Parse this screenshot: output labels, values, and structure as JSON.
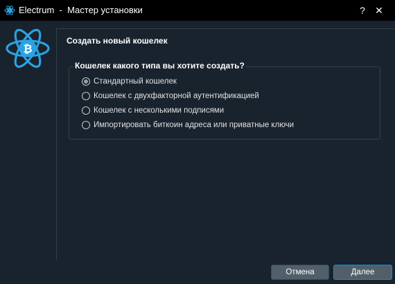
{
  "window": {
    "title": "Electrum  -  Мастер установки",
    "help_label": "?",
    "close_label": "✕"
  },
  "panel": {
    "title": "Создать новый кошелек",
    "group_title": "Кошелек какого типа вы хотите создать?",
    "options": [
      {
        "label": "Стандартный кошелек",
        "checked": true
      },
      {
        "label": "Кошелек с двухфакторной аутентификацией",
        "checked": false
      },
      {
        "label": "Кошелек с несколькими подписями",
        "checked": false
      },
      {
        "label": "Импортировать биткоин адреса или приватные ключи",
        "checked": false
      }
    ]
  },
  "buttons": {
    "cancel": "Отмена",
    "next": "Далее"
  },
  "colors": {
    "background": "#19232d",
    "titlebar": "#000000",
    "accent": "#148cd2",
    "logo": "#2ba2e3"
  }
}
